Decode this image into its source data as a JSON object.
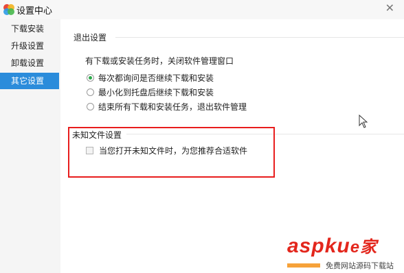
{
  "window": {
    "title": "设置中心",
    "close_symbol": "✕"
  },
  "sidebar": {
    "items": [
      {
        "label": "下载安装",
        "active": false
      },
      {
        "label": "升级设置",
        "active": false
      },
      {
        "label": "卸载设置",
        "active": false
      },
      {
        "label": "其它设置",
        "active": true
      }
    ]
  },
  "exit_settings": {
    "title": "退出设置",
    "description": "有下载或安装任务时，关闭软件管理窗口",
    "options": [
      {
        "label": "每次都询问是否继续下载和安装",
        "checked": true
      },
      {
        "label": "最小化到托盘后继续下载和安装",
        "checked": false
      },
      {
        "label": "结束所有下载和安装任务，退出软件管理",
        "checked": false
      }
    ]
  },
  "unknown_file_settings": {
    "title": "未知文件设置",
    "checkbox_label": "当您打开未知文件时，为您推荐合适软件",
    "checked": false
  },
  "watermark": {
    "logo": "aspku",
    "logo_suffix": "e家",
    "subtitle": "免费网站源码下载站"
  },
  "colors": {
    "accent": "#2b8cdb",
    "radio_checked": "#2aa84a",
    "highlight_box": "#e81c1c"
  },
  "icons": [
    "app-icon",
    "close-icon",
    "mouse-cursor-icon"
  ]
}
